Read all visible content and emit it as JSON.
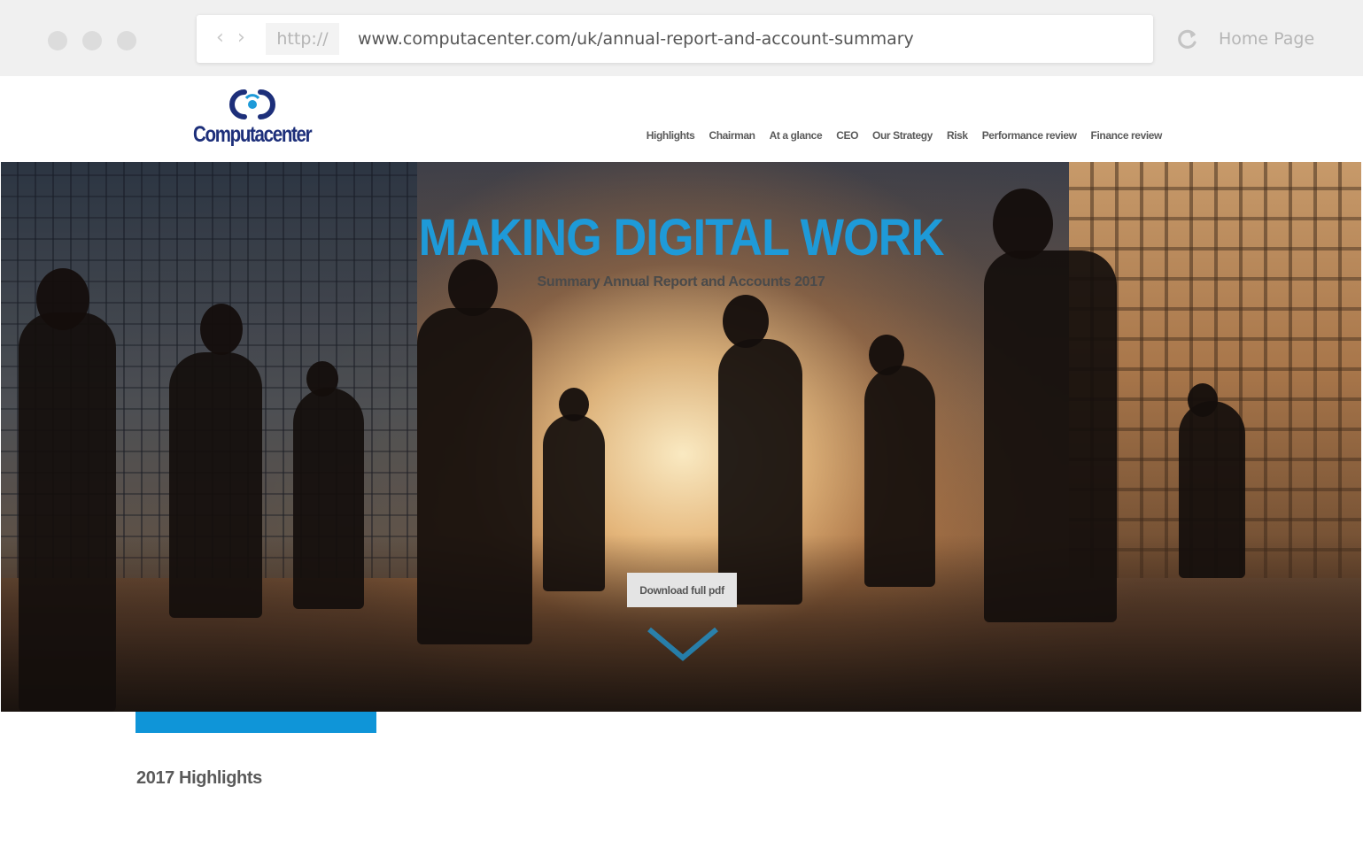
{
  "browser": {
    "protocol": "http://",
    "url": "www.computacenter.com/uk/annual-report-and-account-summary",
    "home_label": "Home Page"
  },
  "header": {
    "logo_text": "Computacenter",
    "nav": [
      "Highlights",
      "Chairman",
      "At a glance",
      "CEO",
      "Our Strategy",
      "Risk",
      "Performance review",
      "Finance review"
    ]
  },
  "hero": {
    "title": "MAKING DIGITAL WORK",
    "subtitle": "Summary Annual Report and Accounts 2017",
    "download_label": "Download full pdf",
    "accent_color": "#1e9ad8"
  },
  "content": {
    "section_title": "2017 Highlights",
    "accent_bar_color": "#0f95d8"
  },
  "icons": {
    "back": "chevron-left-icon",
    "forward": "chevron-right-icon",
    "reload": "reload-icon",
    "scroll": "chevron-down-icon"
  }
}
